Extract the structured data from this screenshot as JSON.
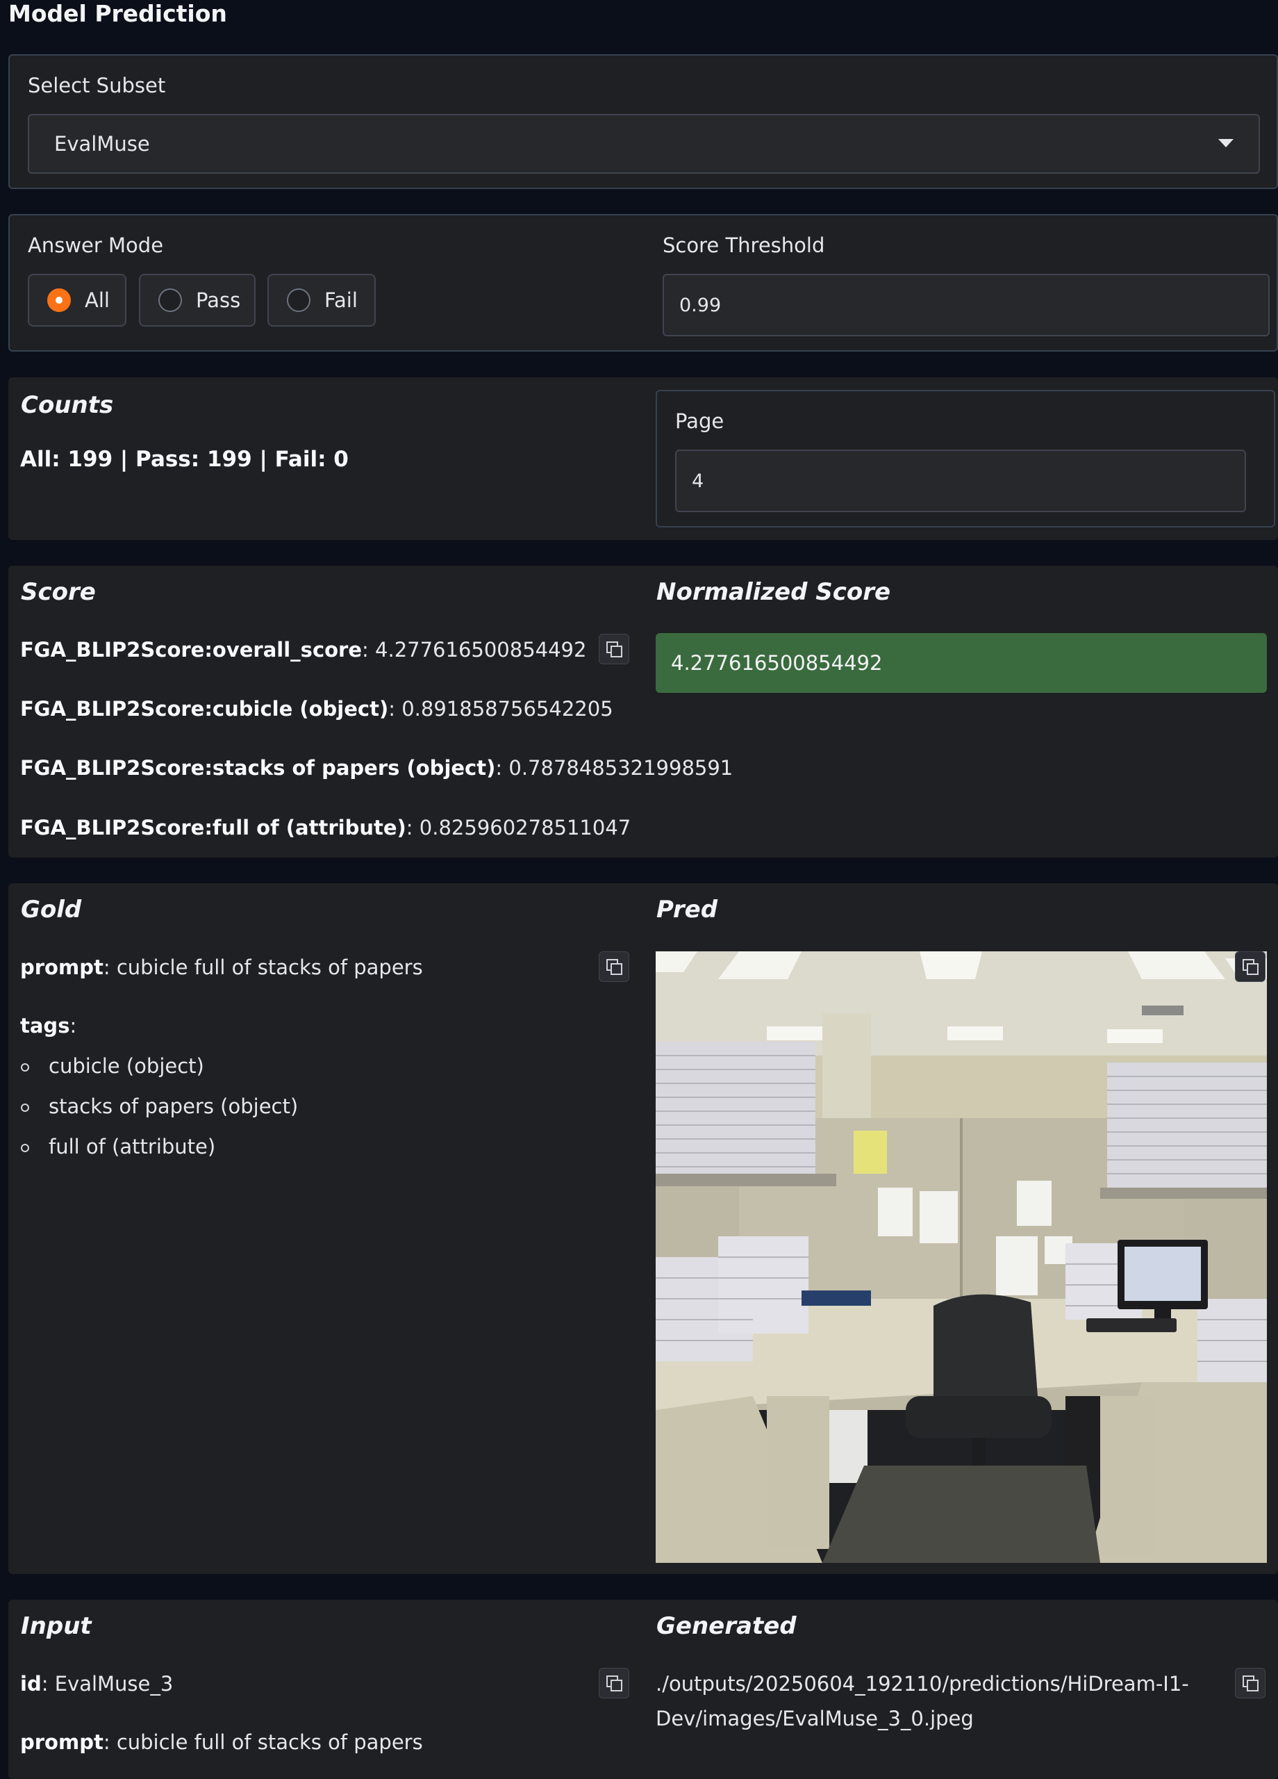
{
  "page_title": "Model Prediction",
  "select_subset": {
    "label": "Select Subset",
    "value": "EvalMuse"
  },
  "answer_mode": {
    "label": "Answer Mode",
    "options": [
      {
        "label": "All",
        "selected": true
      },
      {
        "label": "Pass",
        "selected": false
      },
      {
        "label": "Fail",
        "selected": false
      }
    ]
  },
  "score_threshold": {
    "label": "Score Threshold",
    "value": "0.99"
  },
  "counts": {
    "title": "Counts",
    "text": "All: 199 | Pass: 199 | Fail: 0"
  },
  "page": {
    "label": "Page",
    "value": "4"
  },
  "score": {
    "title": "Score",
    "items": [
      {
        "key": "FGA_BLIP2Score:overall_score",
        "value": "4.277616500854492"
      },
      {
        "key": "FGA_BLIP2Score:cubicle (object)",
        "value": "0.891858756542205"
      },
      {
        "key": "FGA_BLIP2Score:stacks of papers (object)",
        "value": "0.7878485321998591"
      },
      {
        "key": "FGA_BLIP2Score:full of (attribute)",
        "value": "0.825960278511047"
      }
    ]
  },
  "normalized_score": {
    "title": "Normalized Score",
    "value": "4.277616500854492"
  },
  "gold": {
    "title": "Gold",
    "prompt_key": "prompt",
    "prompt_value": "cubicle full of stacks of papers",
    "tags_key": "tags",
    "tags": [
      "cubicle (object)",
      "stacks of papers (object)",
      "full of (attribute)"
    ]
  },
  "pred": {
    "title": "Pred",
    "image_alt": "office cubicle with stacks of papers"
  },
  "input": {
    "title": "Input",
    "id_key": "id",
    "id_value": "EvalMuse_3",
    "prompt_key": "prompt",
    "prompt_value": "cubicle full of stacks of papers"
  },
  "generated": {
    "title": "Generated",
    "path_line1": "./outputs/20250604_192110/predictions/HiDream-I1-",
    "path_line2": "Dev/images/EvalMuse_3_0.jpeg"
  },
  "colors": {
    "accent": "#f97316",
    "normalized_bg": "#3a6b3e",
    "panel_bg": "#1f2023",
    "page_bg": "#0b0f19"
  },
  "icons": {
    "dropdown": "caret-down-icon",
    "copy": "copy-icon"
  }
}
